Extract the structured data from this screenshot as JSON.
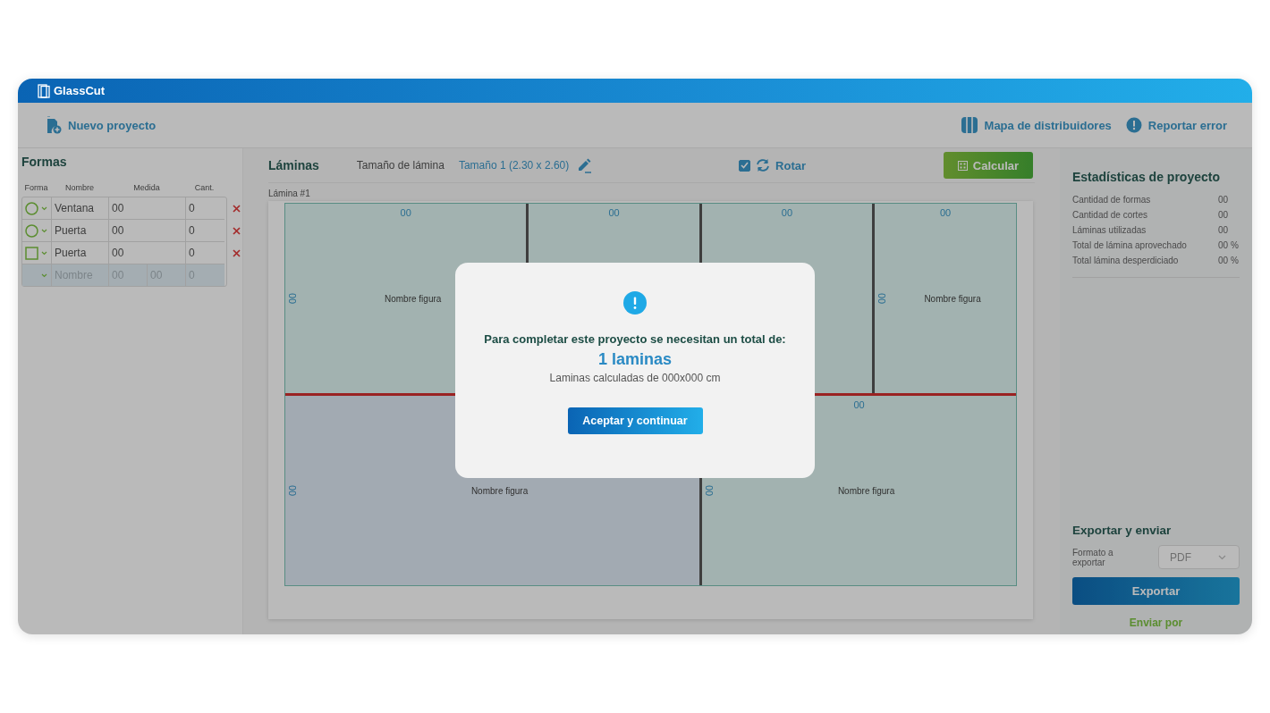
{
  "app": {
    "title": "GlassCut"
  },
  "toolbar": {
    "new_project": "Nuevo proyecto",
    "links": [
      {
        "kind": "map",
        "label": "Mapa de distribuidores"
      },
      {
        "kind": "report",
        "label": "Reportar error"
      }
    ]
  },
  "shapes_panel": {
    "title": "Formas",
    "columns": [
      "Forma",
      "Nombre",
      "Medida",
      "Cant."
    ],
    "rows": [
      {
        "kind": "circle",
        "name": "Ventana",
        "measure": "00",
        "quantity": "0"
      },
      {
        "kind": "circle",
        "name": "Puerta",
        "measure": "00",
        "quantity": "0"
      },
      {
        "kind": "rectangle",
        "name": "Puerta",
        "measure": "00",
        "quantity": "0"
      }
    ],
    "new_row": {
      "name": {
        "placeholder": "Nombre"
      },
      "width": {
        "placeholder": "00"
      },
      "height": {
        "placeholder": "00"
      },
      "quantity": {
        "placeholder": "0"
      }
    }
  },
  "sheets": {
    "title": "Láminas",
    "size_label": "Tamaño de lámina",
    "size_value": "Tamaño 1 (2.30 x 2.60)",
    "rotate": {
      "label": "Rotar",
      "checked": true
    },
    "calculate_button": "Calcular",
    "sheet_label": "Lámina #1",
    "upper_pieces": [
      {
        "kind": "piece",
        "width_label": "00",
        "height_label": "00",
        "name": "Nombre figura"
      },
      {
        "kind": "piece",
        "width_label": "00"
      },
      {
        "kind": "piece",
        "width_label": "00"
      },
      {
        "kind": "piece",
        "width_label": "00",
        "height_label": "00",
        "name": "Nombre figura"
      }
    ],
    "lower_pieces": [
      {
        "kind": "selected-piece",
        "height_label": "00",
        "name": "Nombre figura"
      },
      {
        "kind": "piece",
        "width_label": "00",
        "height_label": "00",
        "name": "Nombre figura"
      }
    ]
  },
  "stats": {
    "title": "Estadísticas de proyecto",
    "items": [
      {
        "label": "Cantidad de formas",
        "value": "00"
      },
      {
        "label": "Cantidad de cortes",
        "value": "00"
      },
      {
        "label": "Láminas utilizadas",
        "value": "00"
      },
      {
        "label": "Total de lámina aprovechado",
        "value": "00 %"
      },
      {
        "label": "Total lámina desperdiciado",
        "value": "00 %"
      }
    ]
  },
  "export": {
    "title": "Exportar y enviar",
    "format_label": "Formato a exportar",
    "format": "PDF",
    "export_button": "Exportar",
    "send_label": "Enviar por"
  },
  "dialog": {
    "title": "Para completar este proyecto se necesitan un total de:",
    "count": "1 laminas",
    "detail": "Laminas calculadas de 000x000 cm",
    "button": "Aceptar y continuar"
  }
}
